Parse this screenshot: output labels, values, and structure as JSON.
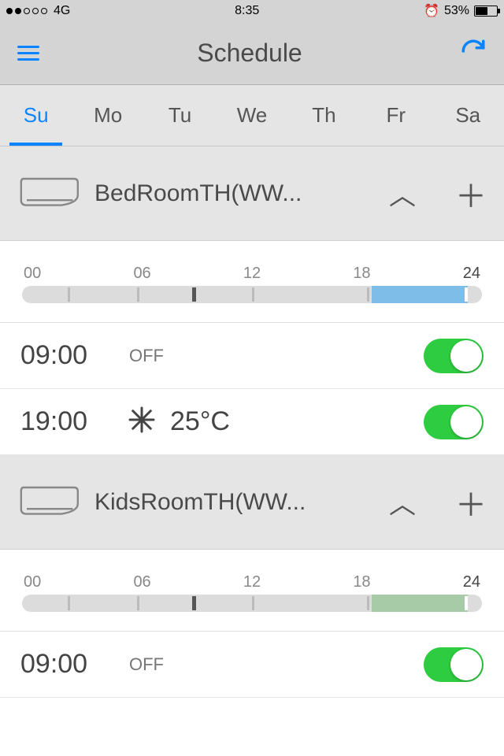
{
  "status": {
    "carrier": "4G",
    "time": "8:35",
    "battery": "53%"
  },
  "nav": {
    "title": "Schedule"
  },
  "tabs": [
    "Su",
    "Mo",
    "Tu",
    "We",
    "Th",
    "Fr",
    "Sa"
  ],
  "active_tab": 0,
  "timeline_labels": [
    "00",
    "06",
    "12",
    "18",
    "24"
  ],
  "devices": [
    {
      "name": "BedRoomTH(WW...",
      "fill_color": "#7fbde9",
      "fill_start_pct": 76,
      "fill_end_pct": 97,
      "dark_tick_pct": 37,
      "schedules": [
        {
          "time": "09:00",
          "mode": "OFF",
          "temp": "",
          "icon": "",
          "on": true
        },
        {
          "time": "19:00",
          "mode": "",
          "temp": "25°C",
          "icon": "snow",
          "on": true
        }
      ]
    },
    {
      "name": "KidsRoomTH(WW...",
      "fill_color": "#a6cba6",
      "fill_start_pct": 76,
      "fill_end_pct": 97,
      "dark_tick_pct": 37,
      "schedules": [
        {
          "time": "09:00",
          "mode": "OFF",
          "temp": "",
          "icon": "",
          "on": true
        }
      ]
    }
  ]
}
